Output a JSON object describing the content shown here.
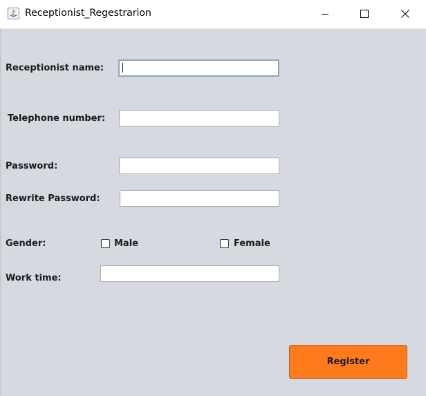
{
  "window": {
    "title": "Receptionist_Regestrarion",
    "minimize_icon": "minimize-icon",
    "maximize_icon": "maximize-icon",
    "close_icon": "close-icon"
  },
  "form": {
    "receptionist_name_label": "Receptionist name:",
    "receptionist_name_value": "",
    "telephone_label": "Telephone number:",
    "telephone_value": "",
    "password_label": "Password:",
    "password_value": "",
    "rewrite_password_label": "Rewrite Password:",
    "rewrite_password_value": "",
    "gender_label": "Gender:",
    "male_label": "Male",
    "male_checked": false,
    "female_label": "Female",
    "female_checked": false,
    "work_time_label": "Work time:",
    "work_time_value": "",
    "register_label": "Register"
  },
  "colors": {
    "background": "#d6d9df",
    "register_button": "#ff7a1c",
    "focused_border": "#8aa9c8"
  }
}
